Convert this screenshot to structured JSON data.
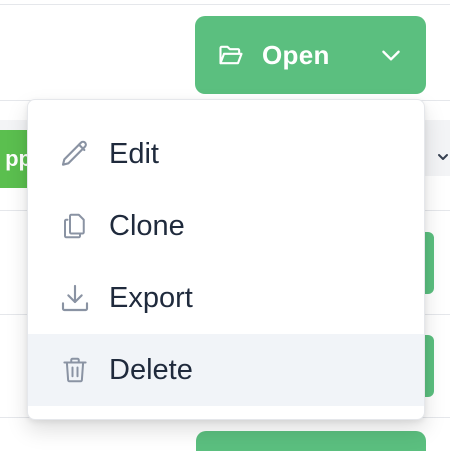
{
  "background": {
    "badge_text": "pp"
  },
  "open_button": {
    "label": "Open",
    "icon": "folder-open-icon",
    "caret_icon": "chevron-down-icon",
    "color": "#5bbf7f"
  },
  "menu": {
    "items": [
      {
        "label": "Edit",
        "icon": "pencil-icon",
        "highlighted": false
      },
      {
        "label": "Clone",
        "icon": "copy-icon",
        "highlighted": false
      },
      {
        "label": "Export",
        "icon": "download-icon",
        "highlighted": false
      },
      {
        "label": "Delete",
        "icon": "trash-icon",
        "highlighted": true
      }
    ]
  },
  "colors": {
    "menu_text": "#1f2a3c",
    "menu_icon": "#8a93a3",
    "highlight": "#f1f4f8"
  }
}
